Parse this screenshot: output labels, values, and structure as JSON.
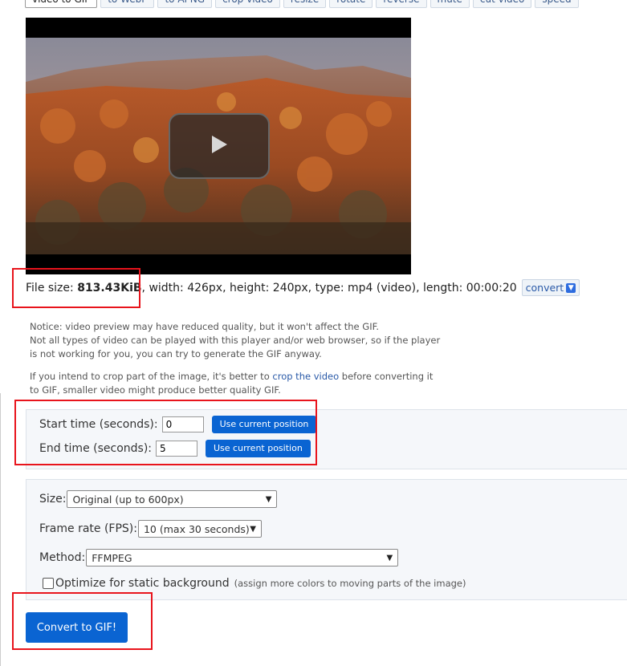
{
  "tabs": [
    {
      "label": "video to GIF",
      "active": true
    },
    {
      "label": "to WebP",
      "active": false
    },
    {
      "label": "to APNG",
      "active": false
    },
    {
      "label": "crop video",
      "active": false
    },
    {
      "label": "resize",
      "active": false
    },
    {
      "label": "rotate",
      "active": false
    },
    {
      "label": "reverse",
      "active": false
    },
    {
      "label": "mute",
      "active": false
    },
    {
      "label": "cut video",
      "active": false
    },
    {
      "label": "speed",
      "active": false
    }
  ],
  "file_info": {
    "prefix": "File size: ",
    "size": "813.43KiB",
    "details": ", width: 426px, height: 240px, type: mp4 (video), length: 00:00:20",
    "convert_label": "convert"
  },
  "notice": {
    "line1": "Notice: video preview may have reduced quality, but it won't affect the GIF.",
    "line2": "Not all types of video can be played with this player and/or web browser, so if the player",
    "line3": "is not working for you, you can try to generate the GIF anyway.",
    "crop_before": "If you intend to crop part of the image, it's better to ",
    "crop_link": "crop the video",
    "crop_after": " before converting it",
    "crop_line2": "to GIF, smaller video might produce better quality GIF."
  },
  "timing": {
    "start_label": "Start time (seconds):",
    "start_value": "0",
    "end_label": "End time (seconds):",
    "end_value": "5",
    "use_position_label": "Use current position"
  },
  "options": {
    "size_label": "Size:",
    "size_value": "Original (up to 600px)",
    "fps_label": "Frame rate (FPS):",
    "fps_value": "10 (max 30 seconds)",
    "method_label": "Method:",
    "method_value": "FFMPEG",
    "optimize_label": "Optimize for static background",
    "optimize_note": "(assign more colors to moving parts of the image)",
    "optimize_checked": false
  },
  "submit_label": "Convert to GIF!",
  "colors": {
    "accent": "#0a64d2",
    "highlight": "#e8141c"
  }
}
